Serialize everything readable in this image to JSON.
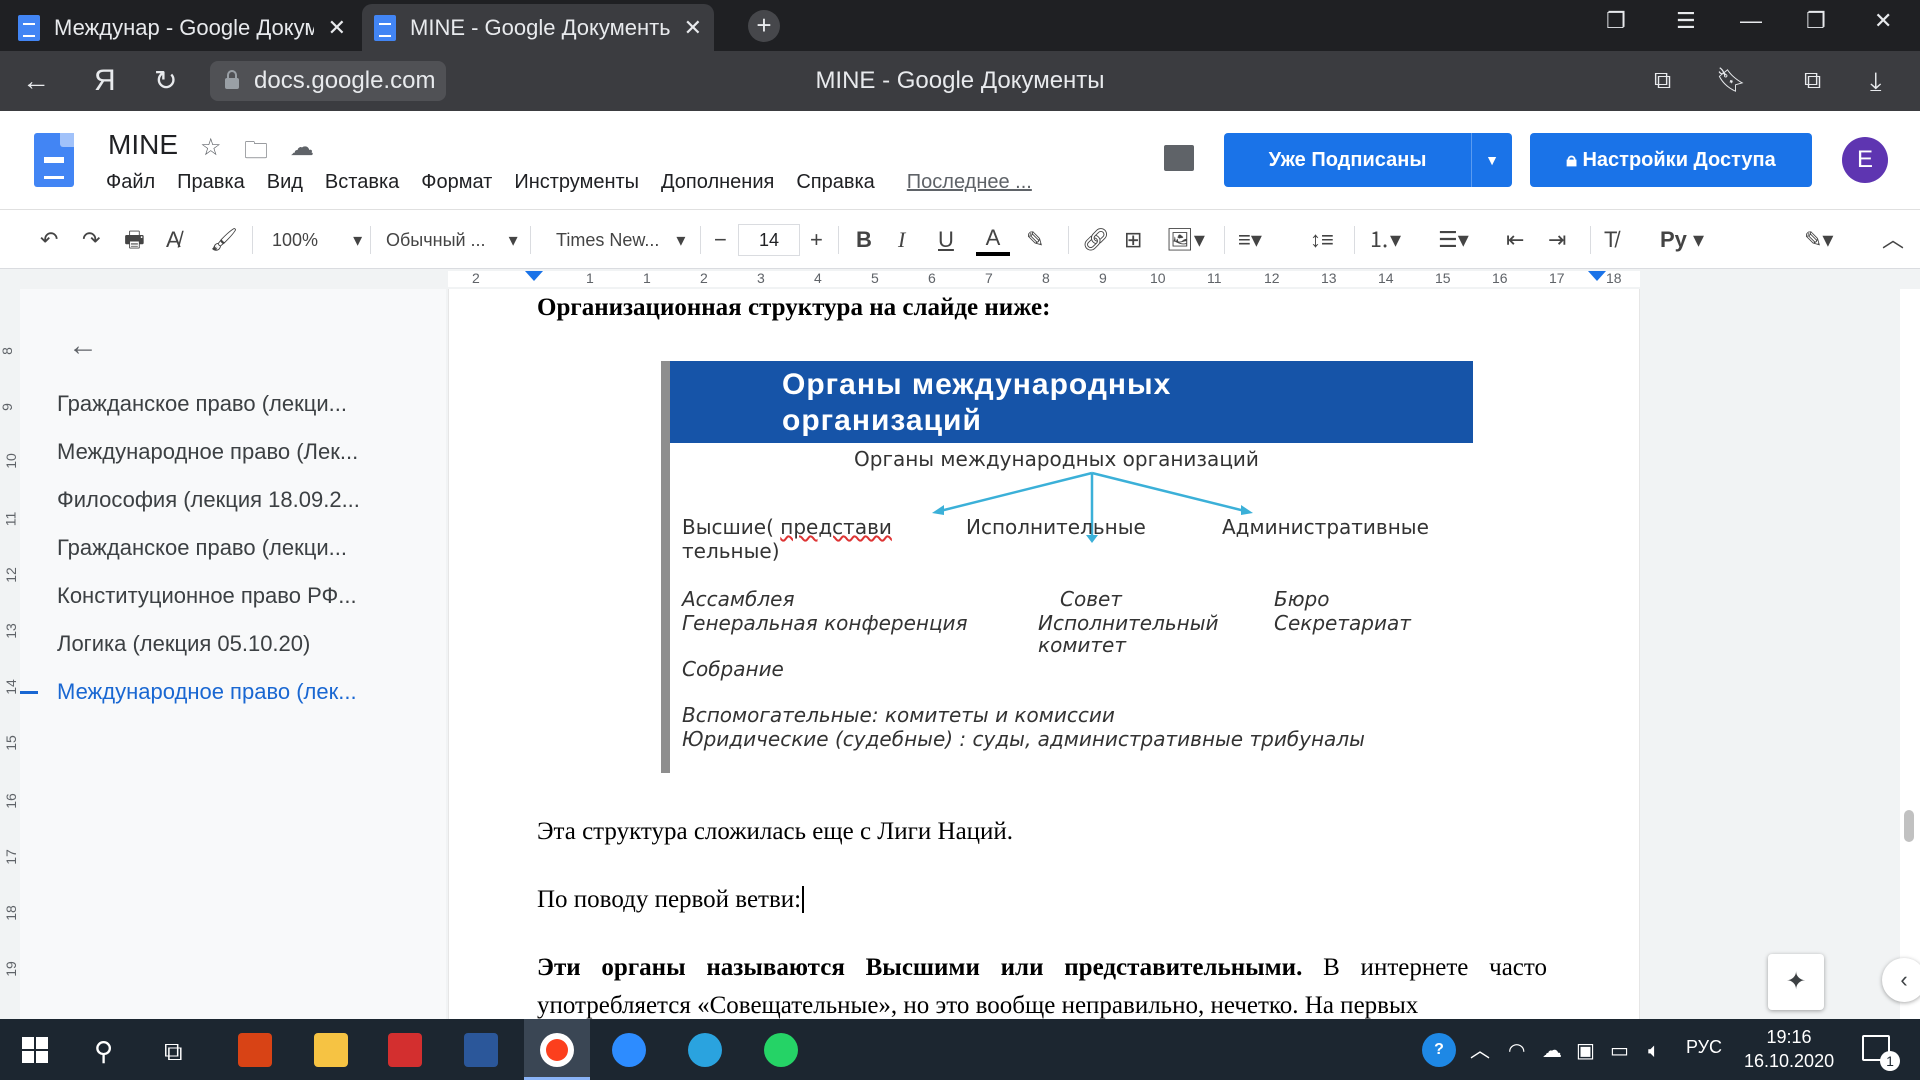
{
  "browser": {
    "tabs": [
      {
        "label": "Международ - Google Документы"
      },
      {
        "label": "MINE - Google Документы"
      }
    ],
    "tab1_label": "Междунар - Google Докумен",
    "tab2_label": "MINE - Google Документы",
    "url": "docs.google.com",
    "page_title": "MINE - Google Документы"
  },
  "doc": {
    "title": "MINE",
    "menu": [
      "Файл",
      "Правка",
      "Вид",
      "Вставка",
      "Формат",
      "Инструменты",
      "Дополнения",
      "Справка"
    ],
    "last_edit": "Последнее ...",
    "subscribed_label": "Уже Подписаны",
    "share_label": "Настройки Доступа",
    "avatar_letter": "E"
  },
  "toolbar": {
    "zoom": "100%",
    "style": "Обычный ...",
    "font": "Times New...",
    "font_size": "14",
    "lang_glyph": "Ру"
  },
  "outline": {
    "items": [
      "Гражданское право (лекци...",
      "Международное право (Лек...",
      "Философия (лекция 18.09.2...",
      "Гражданское право (лекци...",
      "Конституционное право РФ...",
      "Логика (лекция 05.10.20)",
      "Международное право (лек..."
    ],
    "active_index": 6
  },
  "page": {
    "heading": "Организационная структура на слайде ниже:",
    "p1": "Эта структура сложилась еще с Лиги Наций.",
    "p2": "По поводу первой ветви:",
    "p3_bold": "Эти органы называются Высшими или представительными.",
    "p3_rest": " В интернете часто употребляется «Совещательные», но это вообще неправильно, нечетко. На первых"
  },
  "slide": {
    "title_line1": "Органы международных",
    "title_line2": "организаций",
    "root": "Органы международных организаций",
    "b1_a": "Высшие( ",
    "b1_b": "представи",
    "b1_c": "тельные)",
    "b2": "Исполнительные",
    "b3": "Административные",
    "b1_items": [
      "Ассамблея",
      "Генеральная конференция",
      "Собрание"
    ],
    "b2_items": [
      "Совет",
      "Исполнительный",
      "комитет"
    ],
    "b3_items": [
      "Бюро",
      "Секретариат"
    ],
    "note1": "Вспомогательные: комитеты и комиссии",
    "note2": "Юридические (судебные) :  суды, административные трибуналы"
  },
  "ruler": {
    "labels": [
      "2",
      "1",
      "1",
      "2",
      "3",
      "4",
      "5",
      "6",
      "7",
      "8",
      "9",
      "10",
      "11",
      "12",
      "13",
      "14",
      "15",
      "16",
      "17",
      "18"
    ],
    "vlabels": [
      "8",
      "9",
      "10",
      "11",
      "12",
      "13",
      "14",
      "15",
      "16",
      "17",
      "18",
      "19"
    ]
  },
  "taskbar": {
    "lang": "РУС",
    "time": "19:16",
    "date": "16.10.2020",
    "notif_count": "1"
  },
  "colors": {
    "accent": "#1a73e8",
    "slide_header": "#1654a8",
    "avatar": "#5e35b1"
  }
}
